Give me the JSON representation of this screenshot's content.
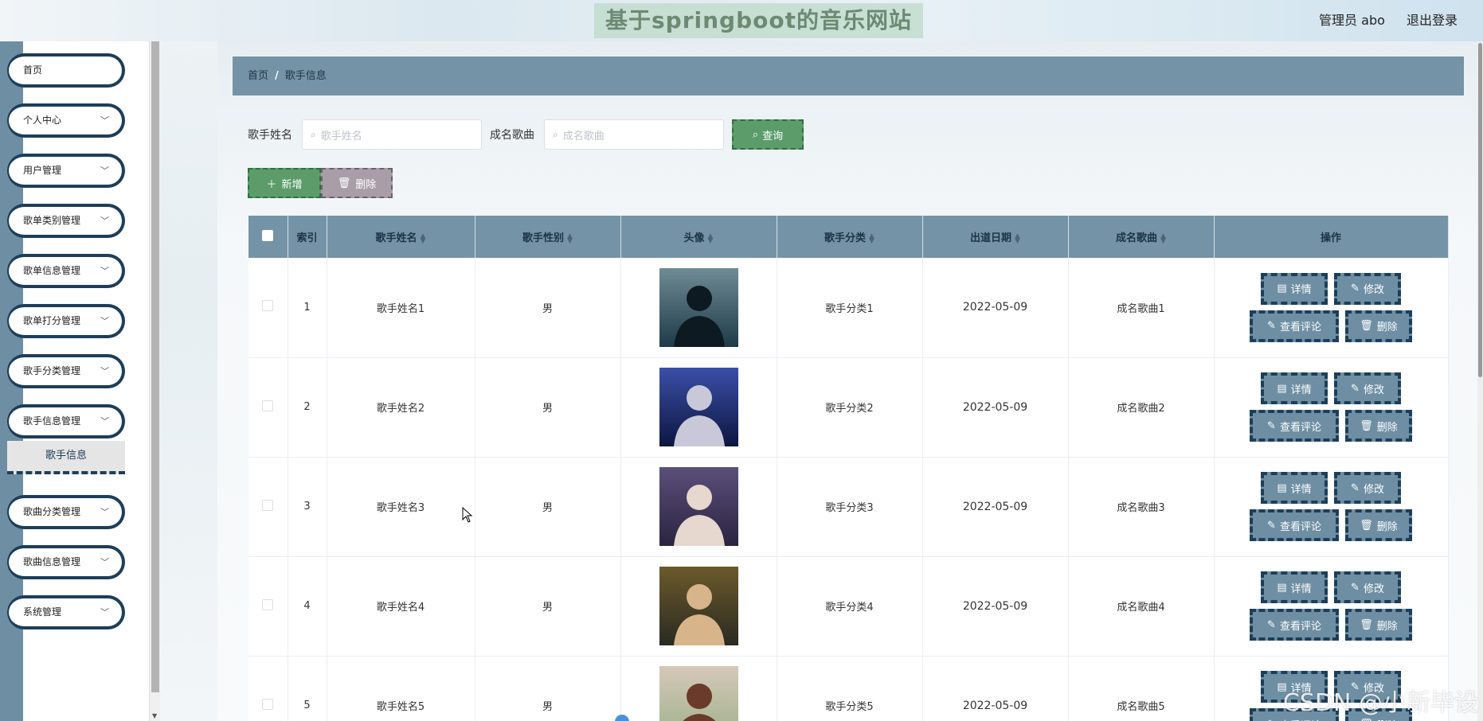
{
  "header": {
    "site_title": "基于springboot的音乐网站",
    "admin_label": "管理员 abo",
    "logout_label": "退出登录"
  },
  "sidebar": {
    "items": [
      {
        "label": "首页",
        "has_chevron": false
      },
      {
        "label": "个人中心",
        "has_chevron": true
      },
      {
        "label": "用户管理",
        "has_chevron": true
      },
      {
        "label": "歌单类别管理",
        "has_chevron": true
      },
      {
        "label": "歌单信息管理",
        "has_chevron": true
      },
      {
        "label": "歌单打分管理",
        "has_chevron": true
      },
      {
        "label": "歌手分类管理",
        "has_chevron": true
      },
      {
        "label": "歌手信息管理",
        "has_chevron": true
      },
      {
        "label": "歌曲分类管理",
        "has_chevron": true
      },
      {
        "label": "歌曲信息管理",
        "has_chevron": true
      },
      {
        "label": "系统管理",
        "has_chevron": true
      }
    ],
    "active_submenu": "歌手信息"
  },
  "breadcrumb": {
    "home": "首页",
    "separator": "/",
    "current": "歌手信息"
  },
  "search": {
    "singer_name_label": "歌手姓名",
    "singer_name_placeholder": "歌手姓名",
    "famous_song_label": "成名歌曲",
    "famous_song_placeholder": "成名歌曲",
    "query_button": "查询"
  },
  "actions": {
    "add_button": "新增",
    "delete_button": "删除"
  },
  "table": {
    "headers": {
      "index": "索引",
      "name": "歌手姓名",
      "gender": "歌手性别",
      "avatar": "头像",
      "category": "歌手分类",
      "debut_date": "出道日期",
      "famous_song": "成名歌曲",
      "operations": "操作"
    },
    "rows": [
      {
        "index": "1",
        "name": "歌手姓名1",
        "gender": "男",
        "category": "歌手分类1",
        "debut_date": "2022-05-09",
        "famous_song": "成名歌曲1"
      },
      {
        "index": "2",
        "name": "歌手姓名2",
        "gender": "男",
        "category": "歌手分类2",
        "debut_date": "2022-05-09",
        "famous_song": "成名歌曲2"
      },
      {
        "index": "3",
        "name": "歌手姓名3",
        "gender": "男",
        "category": "歌手分类3",
        "debut_date": "2022-05-09",
        "famous_song": "成名歌曲3"
      },
      {
        "index": "4",
        "name": "歌手姓名4",
        "gender": "男",
        "category": "歌手分类4",
        "debut_date": "2022-05-09",
        "famous_song": "成名歌曲4"
      },
      {
        "index": "5",
        "name": "歌手姓名5",
        "gender": "男",
        "category": "歌手分类5",
        "debut_date": "2022-05-09",
        "famous_song": "成名歌曲5"
      }
    ],
    "row_buttons": {
      "detail": "详情",
      "edit": "修改",
      "comments": "查看评论",
      "delete": "删除"
    }
  },
  "watermark": "CSDN @小新毕设",
  "colors": {
    "accent": "#6e8fa3",
    "nav_border": "#1d3e5a",
    "green_button": "#5b9c6a",
    "gray_button": "#a99ea8"
  }
}
